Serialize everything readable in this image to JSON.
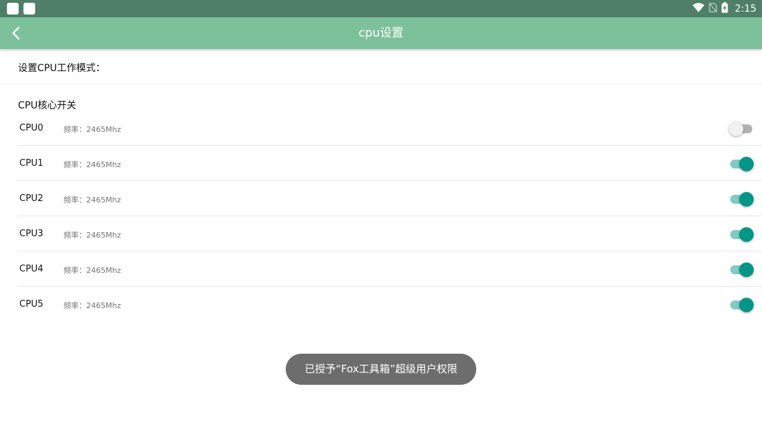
{
  "status_bar": {
    "time": "2:15",
    "icons": [
      "notification-square-icon",
      "notification-square-icon",
      "wifi-icon",
      "no-sim-icon",
      "battery-charging-icon"
    ]
  },
  "app_bar": {
    "title": "cpu设置",
    "back_icon": "back-arrow-icon",
    "background": "#7dc19b"
  },
  "mode_setting": {
    "label": "设置CPU工作模式："
  },
  "core_section": {
    "title": "CPU核心开关",
    "cores": [
      {
        "name": "CPU0",
        "freq": "频率：2465Mhz",
        "enabled": false
      },
      {
        "name": "CPU1",
        "freq": "频率：2465Mhz",
        "enabled": true
      },
      {
        "name": "CPU2",
        "freq": "频率：2465Mhz",
        "enabled": true
      },
      {
        "name": "CPU3",
        "freq": "频率：2465Mhz",
        "enabled": true
      },
      {
        "name": "CPU4",
        "freq": "频率：2465Mhz",
        "enabled": true
      },
      {
        "name": "CPU5",
        "freq": "频率：2465Mhz",
        "enabled": true
      }
    ]
  },
  "toast": {
    "text": "已授予“Fox工具箱”超级用户权限"
  },
  "colors": {
    "status_bar": "#4f7f68",
    "switch_on": "#009688",
    "switch_track_on": "#80cbc4"
  }
}
